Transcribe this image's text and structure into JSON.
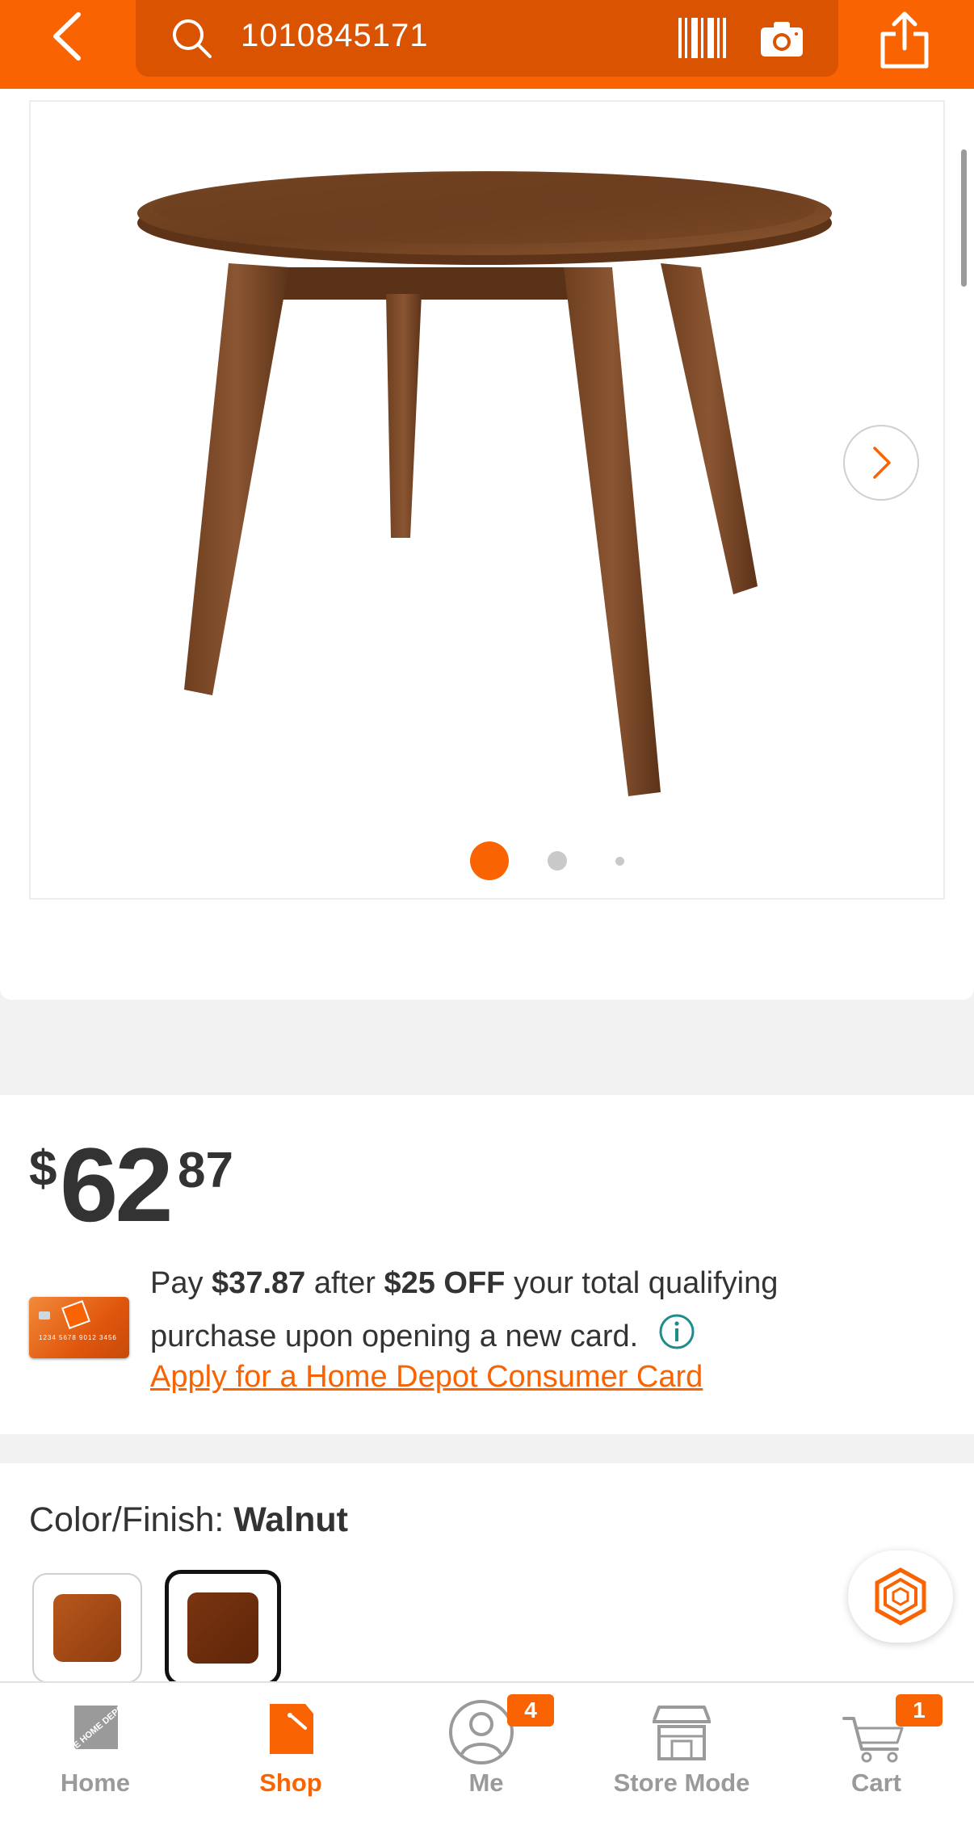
{
  "header": {
    "search_value": "1010845171"
  },
  "gallery": {
    "image_count": 3,
    "active_index": 0
  },
  "price": {
    "currency": "$",
    "whole": "62",
    "cents": "87"
  },
  "promo": {
    "pay_prefix": "Pay ",
    "pay_amount": "$37.87",
    "after": " after ",
    "discount": "$25 OFF",
    "rest": " your total qualifying purchase upon opening a new card.",
    "apply_link": "Apply for a Home Depot Consumer Card",
    "card_number_text": "1234 5678 9012 3456"
  },
  "color": {
    "label": "Color/Finish: ",
    "selected": "Walnut",
    "swatches": [
      "light-walnut",
      "walnut"
    ]
  },
  "nav": {
    "home": "Home",
    "shop": "Shop",
    "me": "Me",
    "store_mode": "Store Mode",
    "cart": "Cart",
    "me_badge": "4",
    "cart_badge": "1",
    "logo_text": "THE HOME DEPOT"
  },
  "colors": {
    "brand_orange": "#f96302",
    "search_bg": "#d95300",
    "text": "#333333"
  },
  "icons": [
    "back-icon",
    "search-icon",
    "barcode-icon",
    "camera-icon",
    "share-icon",
    "chevron-right-icon",
    "info-icon",
    "assistant-icon",
    "home-depot-logo-icon",
    "shop-bag-icon",
    "person-icon",
    "store-icon",
    "cart-icon"
  ]
}
